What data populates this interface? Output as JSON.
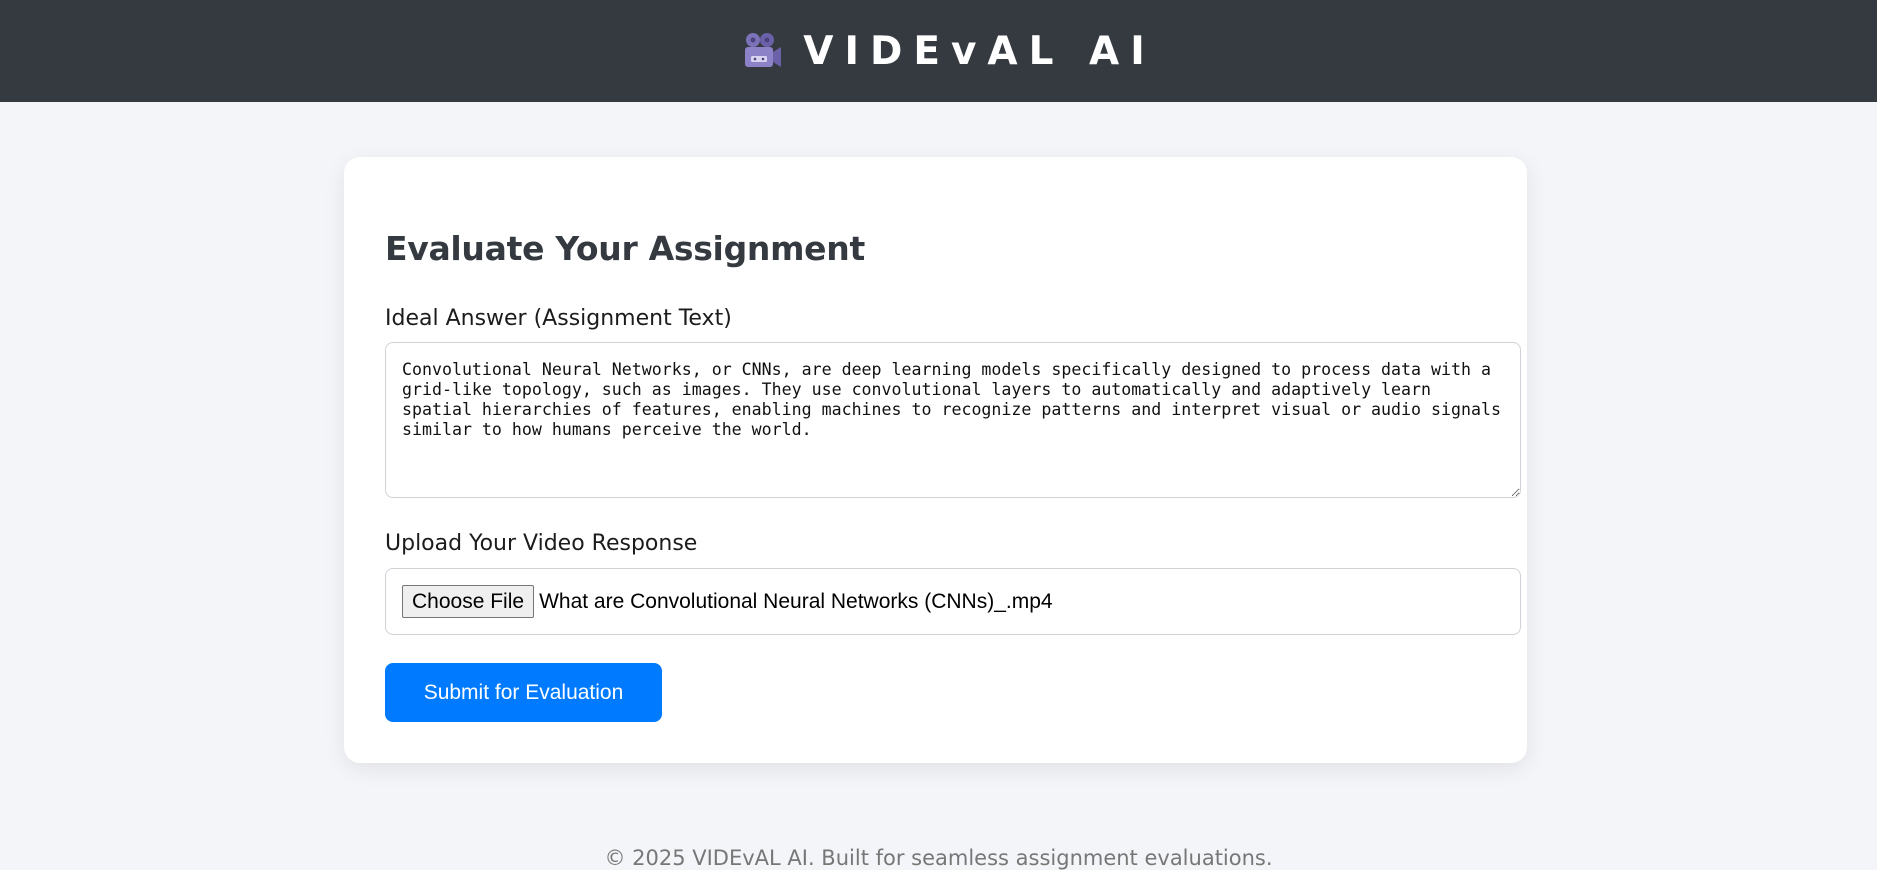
{
  "header": {
    "brand_icon": "movie-camera-icon",
    "brand_name": "VIDEvAL AI",
    "bg_color": "#343a40"
  },
  "form": {
    "title": "Evaluate Your Assignment",
    "ideal_answer_label": "Ideal Answer (Assignment Text)",
    "ideal_answer_value": "Convolutional Neural Networks, or CNNs, are deep learning models specifically designed to process data with a grid-like topology, such as images. They use convolutional layers to automatically and adaptively learn spatial hierarchies of features, enabling machines to recognize patterns and interpret visual or audio signals similar to how humans perceive the world.",
    "upload_label": "Upload Your Video Response",
    "choose_file_label": "Choose File",
    "selected_file_name": "What are Convolutional Neural Networks (CNNs)_.mp4",
    "submit_label": "Submit for Evaluation",
    "accent_color": "#007bff"
  },
  "footer": {
    "text": "© 2025 VIDEvAL AI. Built for seamless assignment evaluations."
  }
}
